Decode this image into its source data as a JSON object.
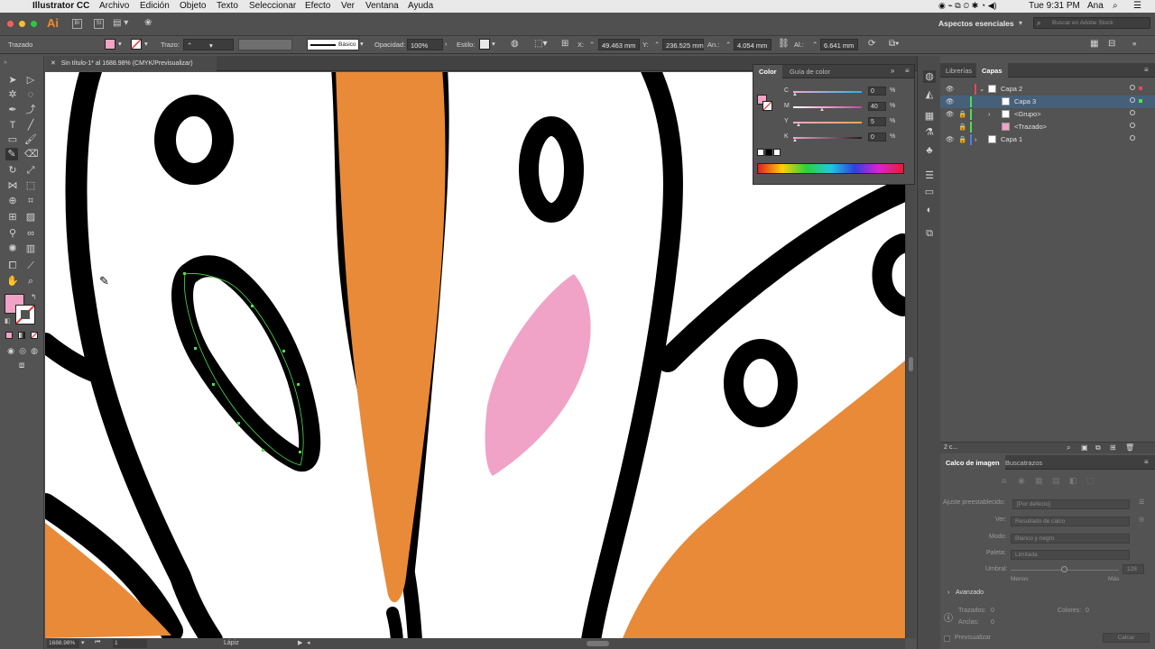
{
  "menubar": {
    "app_name": "Illustrator CC",
    "items": [
      "Archivo",
      "Edición",
      "Objeto",
      "Texto",
      "Seleccionar",
      "Efecto",
      "Ver",
      "Ventana",
      "Ayuda"
    ],
    "clock": "Tue 9:31 PM",
    "user": "Ana"
  },
  "appbar": {
    "logo": "Ai",
    "workspace": "Aspectos esenciales",
    "search_placeholder": "Buscar en Adobe Stock"
  },
  "control": {
    "selection_type": "Trazado",
    "fill_color": "#f0a3c6",
    "stroke_label": "Trazo:",
    "stroke_profile": "Básico",
    "opacity_label": "Opacidad:",
    "opacity_value": "100%",
    "style_label": "Estilo:",
    "x_label": "X:",
    "x_value": "49.463 mm",
    "y_label": "Y:",
    "y_value": "236.525 mm",
    "w_label": "An.:",
    "w_value": "4.054 mm",
    "h_label": "Al.:",
    "h_value": "6.641 mm"
  },
  "document": {
    "tab_title": "Sin título-1* al 1688.98% (CMYK/Previsualizar)",
    "zoom": "1688.98%",
    "artboard": "1",
    "status_tool": "Lápiz"
  },
  "color_panel": {
    "tabs": [
      "Color",
      "Guía de color"
    ],
    "active_tab": "Color",
    "swatch": "#f0a3c6",
    "channels": [
      {
        "label": "C",
        "value": "0",
        "unit": "%",
        "color": "#2bb3e6"
      },
      {
        "label": "M",
        "value": "40",
        "unit": "%",
        "color": "#e0399a"
      },
      {
        "label": "Y",
        "value": "5",
        "unit": "%",
        "color": "#e8d23a"
      },
      {
        "label": "K",
        "value": "0",
        "unit": "%",
        "color": "#222222"
      }
    ]
  },
  "layers_panel": {
    "tabs": [
      "Librerías",
      "Capas"
    ],
    "active_tab": "Capas",
    "rows": [
      {
        "name": "Capa 2",
        "color": "#e6475c",
        "selected": false
      },
      {
        "name": "Capa 3",
        "color": "#e6475c",
        "selected": true
      },
      {
        "name": "<Grupo>",
        "color": "#e6475c",
        "selected": false
      },
      {
        "name": "<Trazado>",
        "color": "#e6475c",
        "selected": false
      },
      {
        "name": "Capa 1",
        "color": "#4f7cf0",
        "selected": false
      }
    ],
    "count": "2 c..."
  },
  "trace_panel": {
    "tabs": [
      "Calco de imagen",
      "Buscatrazos"
    ],
    "active_tab": "Calco de imagen",
    "preset_label": "Ajuste preestablecido:",
    "preset_value": "[Por defecto]",
    "view_label": "Ver:",
    "view_value": "Resultado de calco",
    "mode_label": "Modo:",
    "mode_value": "Blanco y negro",
    "palette_label": "Paleta:",
    "palette_value": "Limitada",
    "threshold_label": "Umbral:",
    "threshold_value": "128",
    "less": "Menos",
    "more": "Más",
    "advanced": "Avanzado",
    "paths_label": "Trazados:",
    "paths_value": "0",
    "colors_label": "Colores:",
    "colors_value": "0",
    "anchors_label": "Anclas:",
    "anchors_value": "0",
    "preview_label": "Previsualizar",
    "trace_button": "Calcar"
  },
  "colors": {
    "orange": "#e98a38",
    "pink": "#f0a3c6",
    "selection_green": "#4ee04e",
    "ink": "#000000"
  }
}
